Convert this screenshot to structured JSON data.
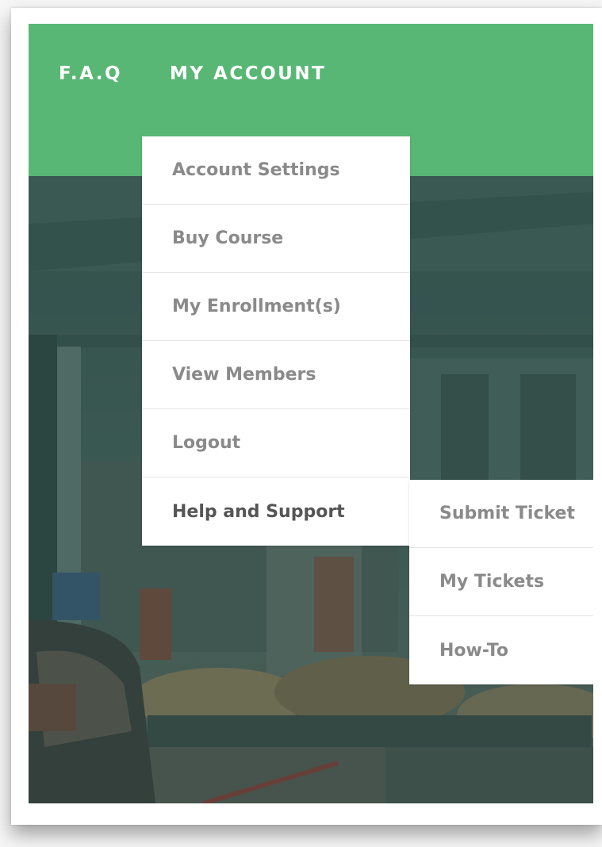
{
  "nav": {
    "links": [
      {
        "label": "F.A.Q"
      },
      {
        "label": "MY ACCOUNT"
      }
    ],
    "colors": {
      "bar": "#58b774",
      "text": "#ffffff"
    }
  },
  "dropdown": {
    "items": [
      {
        "label": "Account Settings"
      },
      {
        "label": "Buy Course"
      },
      {
        "label": "My Enrollment(s)"
      },
      {
        "label": "View Members"
      },
      {
        "label": "Logout"
      },
      {
        "label": "Help and Support"
      }
    ],
    "active": "Help and Support"
  },
  "submenu": {
    "items": [
      {
        "label": "Submit Ticket"
      },
      {
        "label": "My Tickets"
      },
      {
        "label": "How-To"
      }
    ]
  }
}
